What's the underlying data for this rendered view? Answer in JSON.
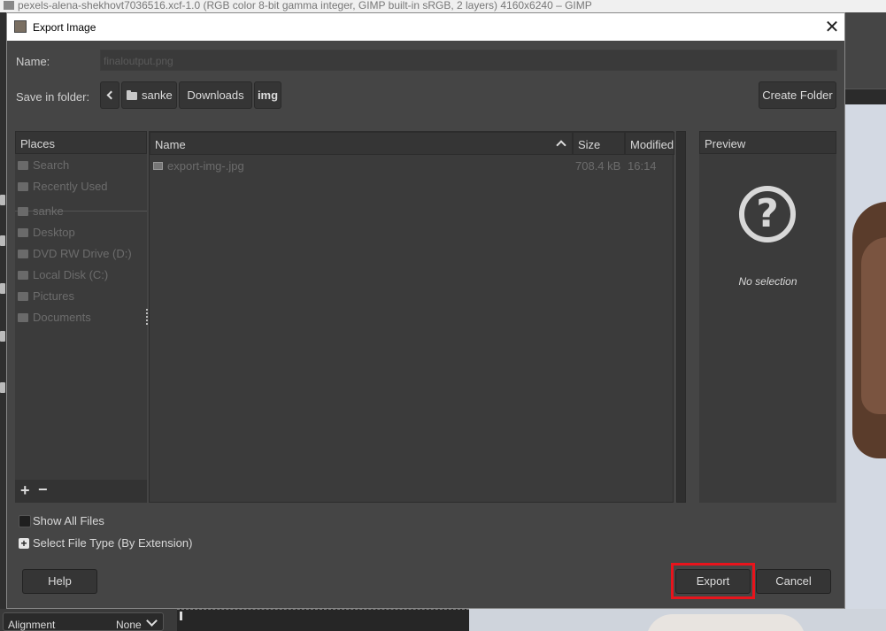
{
  "background_window": {
    "title": "pexels-alena-shekhovt7036516.xcf-1.0 (RGB color 8-bit gamma integer, GIMP built-in sRGB, 2 layers) 4160x6240 – GIMP",
    "alignment_label": "Alignment",
    "alignment_value": "None"
  },
  "dialog": {
    "title": "Export Image",
    "close_icon": "close-icon",
    "name_label": "Name:",
    "name_value": "finaloutput.png",
    "save_in_folder_label": "Save in folder:",
    "breadcrumb": [
      {
        "label": "sanke",
        "icon": "folder-icon"
      },
      {
        "label": "Downloads"
      },
      {
        "label": "img",
        "current": true
      }
    ],
    "create_folder_label": "Create Folder",
    "places": {
      "header": "Places",
      "items": [
        {
          "label": "Search",
          "icon": "search-icon"
        },
        {
          "label": "Recently Used",
          "icon": "recent-icon"
        },
        {
          "label": "sanke",
          "icon": "folder-icon"
        },
        {
          "label": "Desktop",
          "icon": "folder-icon"
        },
        {
          "label": "DVD RW Drive (D:)",
          "icon": "optical-drive-icon"
        },
        {
          "label": "Local Disk (C:)",
          "icon": "disk-icon"
        },
        {
          "label": "Pictures",
          "icon": "folder-icon"
        },
        {
          "label": "Documents",
          "icon": "folder-icon"
        }
      ],
      "add_label": "+",
      "remove_label": "−"
    },
    "file_list": {
      "columns": [
        "Name",
        "Size",
        "Modified"
      ],
      "rows": [
        {
          "name": "export-img-.jpg",
          "size": "708.4 kB",
          "modified": "16:14",
          "icon": "image-file-icon"
        }
      ]
    },
    "preview": {
      "header": "Preview",
      "icon": "help-circle-icon",
      "icon_glyph": "?",
      "empty_text": "No selection"
    },
    "show_all_files_label": "Show All Files",
    "select_file_type_label": "Select File Type (By Extension)",
    "expander_glyph": "+",
    "buttons": {
      "help": "Help",
      "export": "Export",
      "cancel": "Cancel"
    },
    "highlight_color": "#e8141c"
  }
}
